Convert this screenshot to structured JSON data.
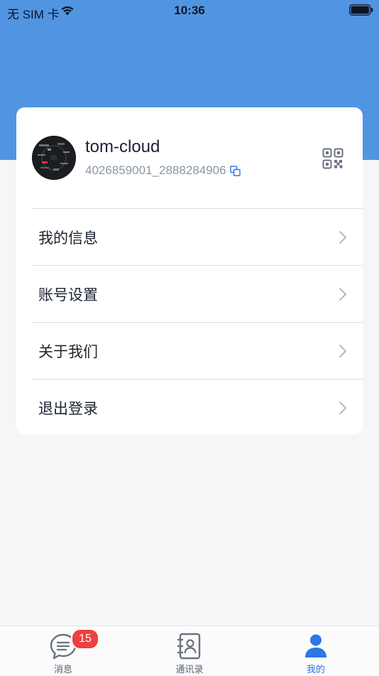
{
  "status_bar": {
    "carrier": "无 SIM 卡",
    "time": "10:36"
  },
  "profile": {
    "name": "tom-cloud",
    "id": "4026859001_2888284906"
  },
  "menu": {
    "items": [
      {
        "label": "我的信息"
      },
      {
        "label": "账号设置"
      },
      {
        "label": "关于我们"
      },
      {
        "label": "退出登录"
      }
    ]
  },
  "tab_bar": {
    "tabs": [
      {
        "label": "消息",
        "icon": "message-icon",
        "badge": "15",
        "active": false
      },
      {
        "label": "通讯录",
        "icon": "contacts-icon",
        "active": false
      },
      {
        "label": "我的",
        "icon": "person-icon",
        "active": true
      }
    ]
  },
  "colors": {
    "header_blue": "#5195e2",
    "accent": "#2b78e4",
    "badge_red": "#ef4040"
  }
}
